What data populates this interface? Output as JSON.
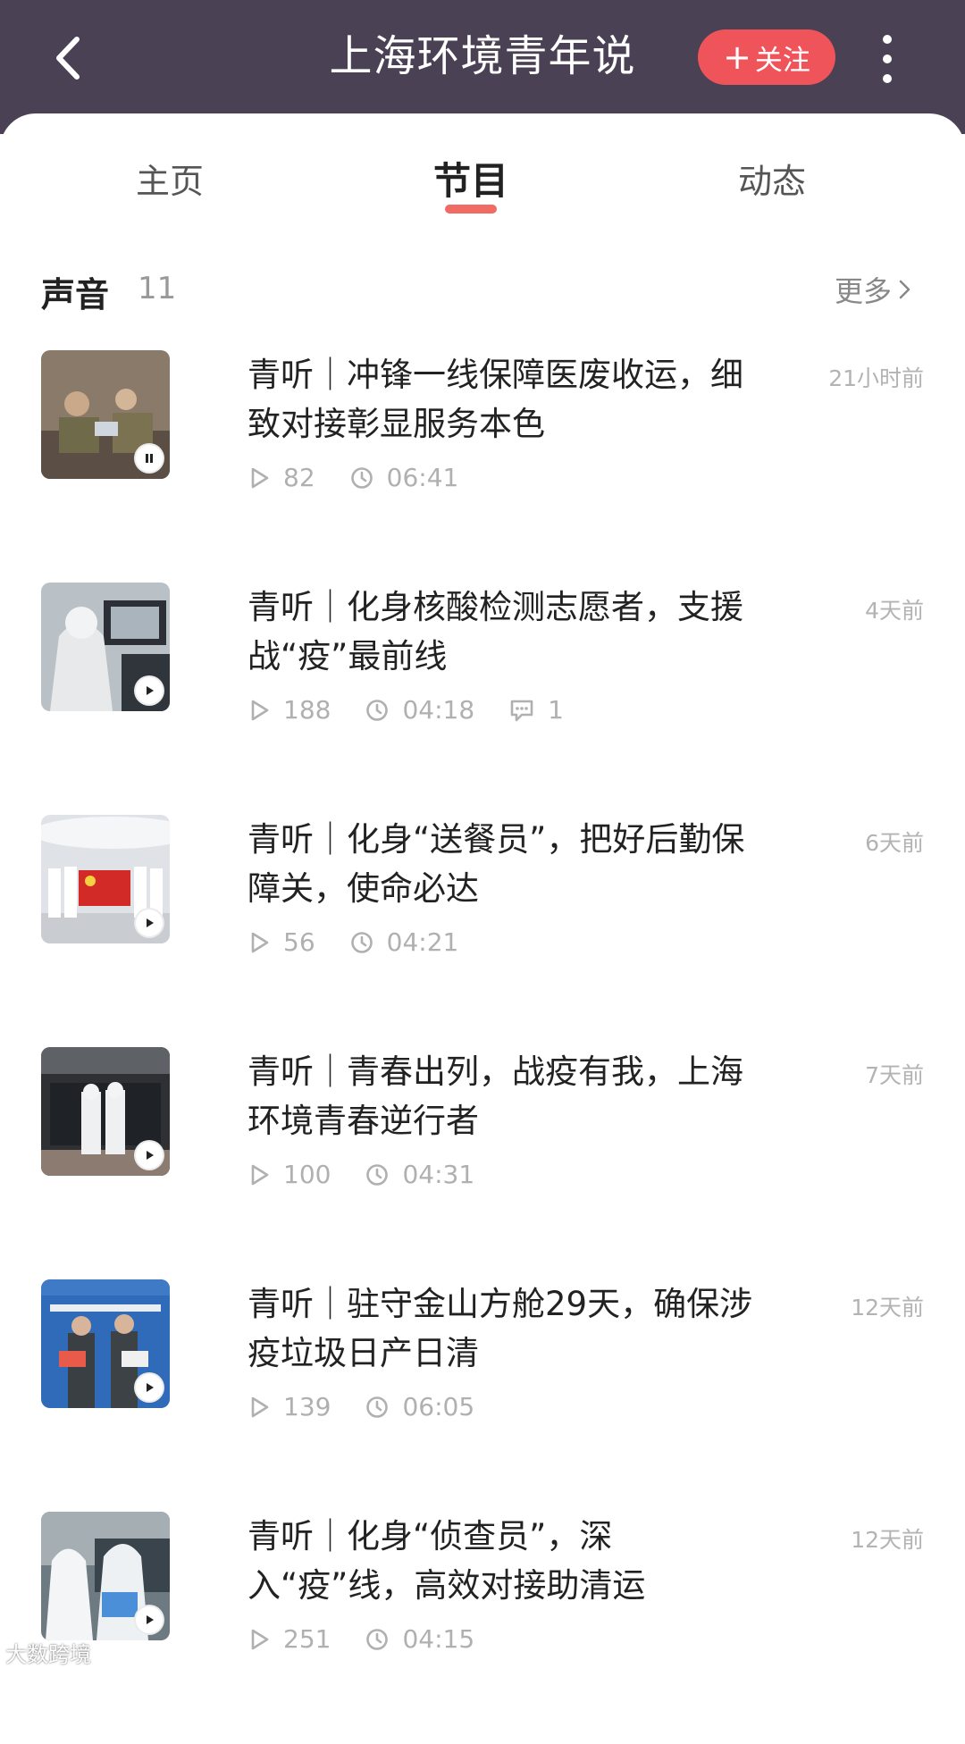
{
  "header": {
    "title": "上海环境青年说",
    "follow_label": "关注"
  },
  "tabs": [
    {
      "label": "主页"
    },
    {
      "label": "节目"
    },
    {
      "label": "动态"
    }
  ],
  "section": {
    "title": "声音",
    "count": "11",
    "more_label": "更多"
  },
  "episodes": [
    {
      "title": "青听｜冲锋一线保障医废收运，细致对接彰显服务本色",
      "time": "21小时前",
      "plays": "82",
      "duration": "06:41",
      "comments": "",
      "state": "paused"
    },
    {
      "title": "青听｜化身核酸检测志愿者，支援战“疫”最前线",
      "time": "4天前",
      "plays": "188",
      "duration": "04:18",
      "comments": "1",
      "state": "play"
    },
    {
      "title": "青听｜化身“送餐员”，把好后勤保障关，使命必达",
      "time": "6天前",
      "plays": "56",
      "duration": "04:21",
      "comments": "",
      "state": "play"
    },
    {
      "title": "青听｜青春出列，战疫有我，上海环境青春逆行者",
      "time": "7天前",
      "plays": "100",
      "duration": "04:31",
      "comments": "",
      "state": "play"
    },
    {
      "title": "青听｜驻守金山方舱29天，确保涉疫垃圾日产日清",
      "time": "12天前",
      "plays": "139",
      "duration": "06:05",
      "comments": "",
      "state": "play"
    },
    {
      "title": "青听｜化身“侦查员”，深入“疫”线，高效对接助清运",
      "time": "12天前",
      "plays": "251",
      "duration": "04:15",
      "comments": "",
      "state": "play"
    }
  ],
  "watermark": "大数跨境",
  "colors": {
    "header_bg": "#4b4154",
    "accent": "#f0545b",
    "tab_indicator": "#f06b63"
  }
}
